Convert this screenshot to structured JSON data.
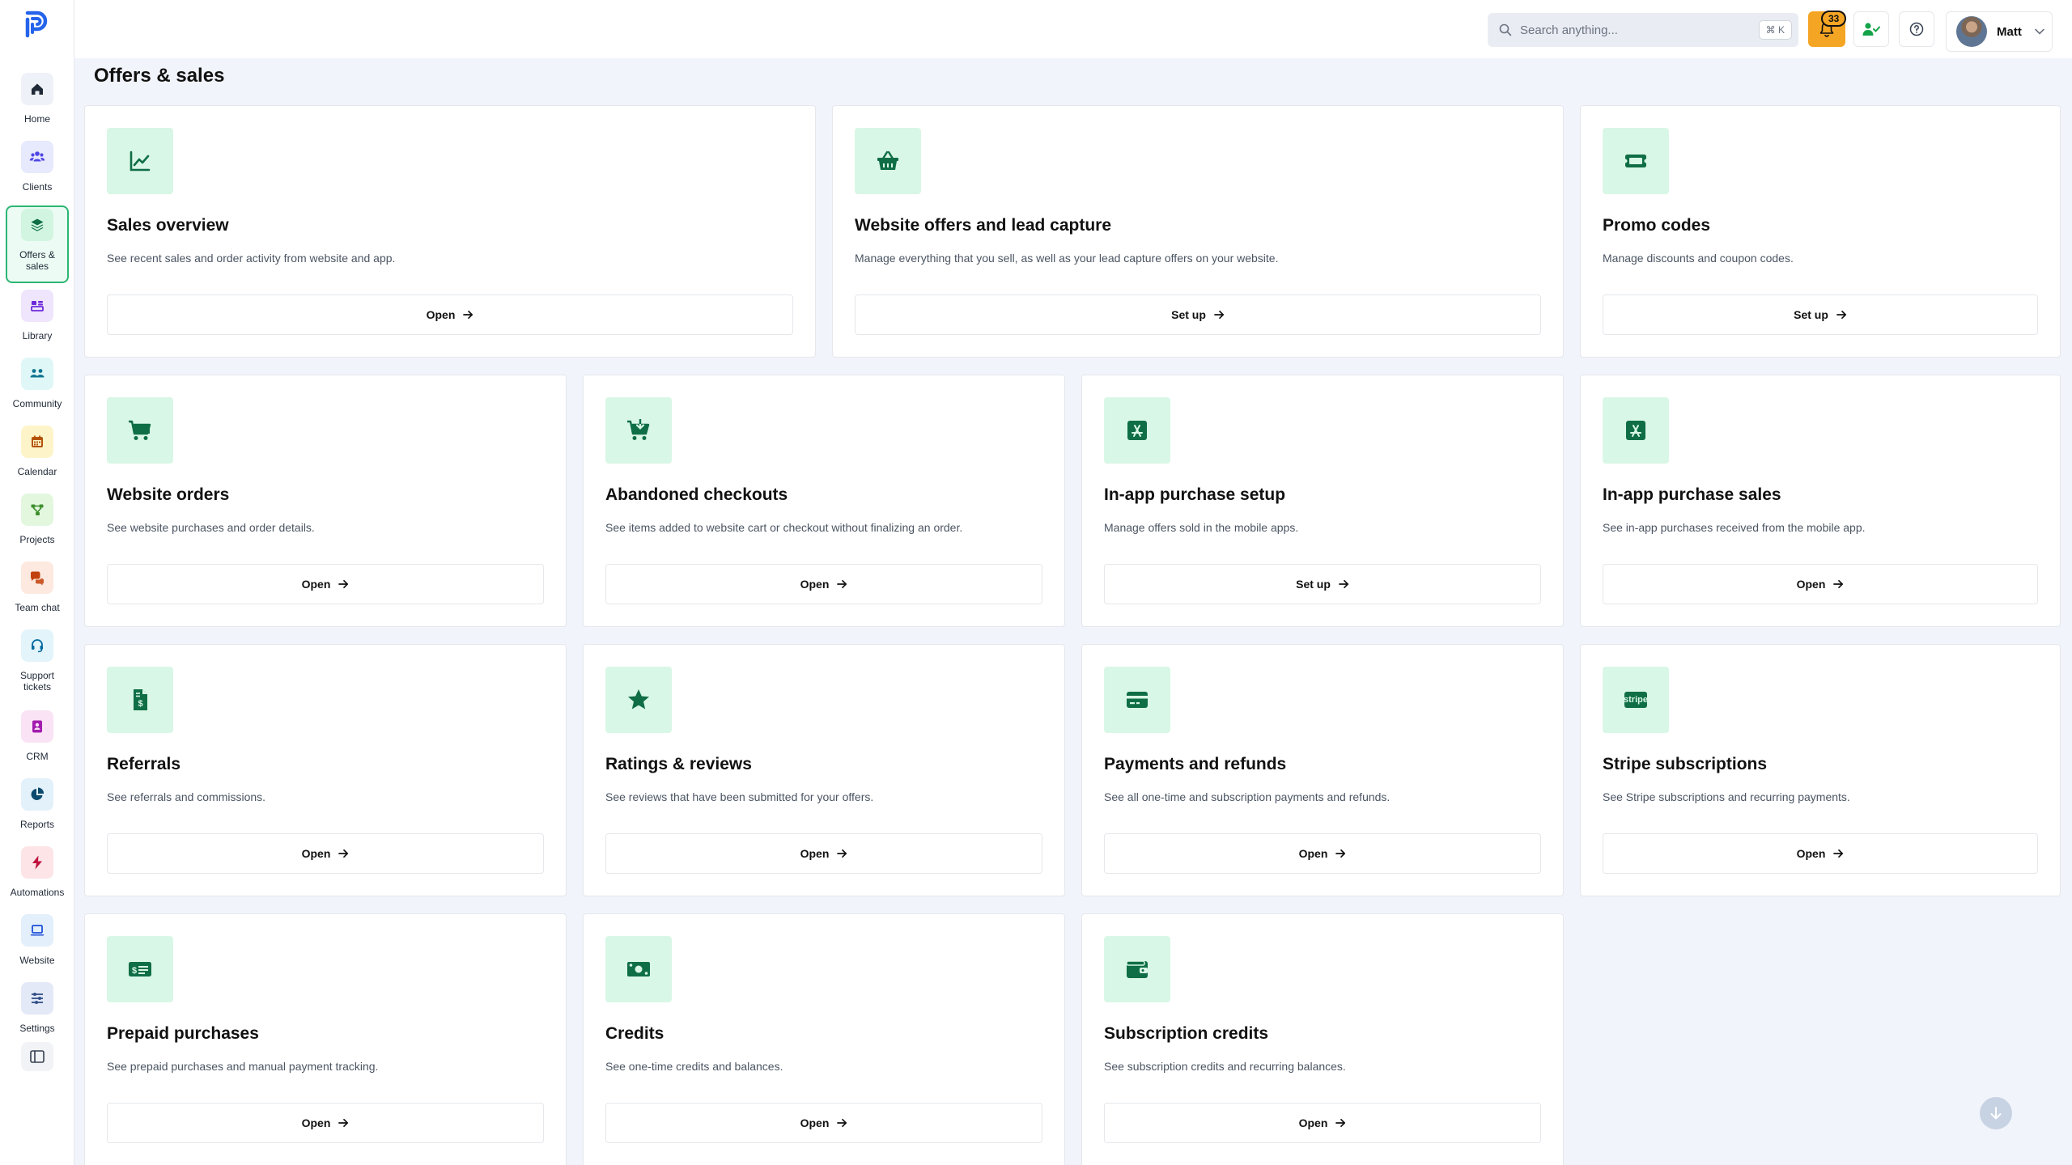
{
  "app": {
    "title": "Offers & sales"
  },
  "sidebar": {
    "items": [
      {
        "label": "Home",
        "icon": "home-icon",
        "bg": "#eef1f7",
        "fg": "#1f2937"
      },
      {
        "label": "Clients",
        "icon": "users-icon",
        "bg": "#e7e9fd",
        "fg": "#4f46e5"
      },
      {
        "label": "Offers &\nsales",
        "icon": "layers-icon",
        "bg": "#d1f5e0",
        "fg": "#0f6e46"
      },
      {
        "label": "Library",
        "icon": "library-icon",
        "bg": "#efe5fd",
        "fg": "#6d28d9"
      },
      {
        "label": "Community",
        "icon": "community-icon",
        "bg": "#e0f7f7",
        "fg": "#0e7490"
      },
      {
        "label": "Calendar",
        "icon": "calendar-icon",
        "bg": "#fdf4c9",
        "fg": "#b45309"
      },
      {
        "label": "Projects",
        "icon": "projects-icon",
        "bg": "#e3f7df",
        "fg": "#3f8f2f"
      },
      {
        "label": "Team chat",
        "icon": "chat-icon",
        "bg": "#fde9df",
        "fg": "#c2410c"
      },
      {
        "label": "Support\ntickets",
        "icon": "headset-icon",
        "bg": "#e3f4fb",
        "fg": "#0369a1"
      },
      {
        "label": "CRM",
        "icon": "crm-icon",
        "bg": "#f9e3f5",
        "fg": "#a21caf"
      },
      {
        "label": "Reports",
        "icon": "pie-chart-icon",
        "bg": "#e3f1fb",
        "fg": "#0c4a6e"
      },
      {
        "label": "Automations",
        "icon": "bolt-icon",
        "bg": "#fde4e7",
        "fg": "#be123c"
      },
      {
        "label": "Website",
        "icon": "laptop-icon",
        "bg": "#e3effb",
        "fg": "#1d4ed8"
      },
      {
        "label": "Settings",
        "icon": "sliders-icon",
        "bg": "#e3e9f6",
        "fg": "#334e8a"
      }
    ]
  },
  "topbar": {
    "search_placeholder": "Search anything...",
    "search_shortcut": "⌘ K",
    "notifications_count": "33",
    "user_name": "Matt"
  },
  "main": {
    "title": "Offers & sales",
    "cards": [
      {
        "title": "Sales overview",
        "desc": "See recent sales and order activity from website and app.",
        "button": "Open",
        "icon": "line-chart-icon"
      },
      {
        "title": "Website offers and lead capture",
        "desc": "Manage everything that you sell, as well as your lead capture offers on your website.",
        "button": "Set up",
        "icon": "basket-icon"
      },
      {
        "title": "Promo codes",
        "desc": "Manage discounts and coupon codes.",
        "button": "Set up",
        "icon": "ticket-icon"
      },
      {
        "title": "Website orders",
        "desc": "See website purchases and order details.",
        "button": "Open",
        "icon": "cart-icon"
      },
      {
        "title": "Abandoned checkouts",
        "desc": "See items added to website cart or checkout without finalizing an order.",
        "button": "Open",
        "icon": "cart-arrow-icon"
      },
      {
        "title": "In-app purchase setup",
        "desc": "Manage offers sold in the mobile apps.",
        "button": "Set up",
        "icon": "app-store-icon"
      },
      {
        "title": "In-app purchase sales",
        "desc": "See in-app purchases received from the mobile app.",
        "button": "Open",
        "icon": "app-store-icon"
      },
      {
        "title": "Referrals",
        "desc": "See referrals and commissions.",
        "button": "Open",
        "icon": "invoice-dollar-icon"
      },
      {
        "title": "Ratings & reviews",
        "desc": "See reviews that have been submitted for your offers.",
        "button": "Open",
        "icon": "star-icon"
      },
      {
        "title": "Payments and refunds",
        "desc": "See all one-time and subscription payments and refunds.",
        "button": "Open",
        "icon": "credit-card-icon"
      },
      {
        "title": "Stripe subscriptions",
        "desc": "See Stripe subscriptions and recurring payments.",
        "button": "Open",
        "icon": "stripe-icon",
        "icon_text": "stripe"
      },
      {
        "title": "Prepaid purchases",
        "desc": "See prepaid purchases and manual payment tracking.",
        "button": "Open",
        "icon": "money-check-icon"
      },
      {
        "title": "Credits",
        "desc": "See one-time credits and balances.",
        "button": "Open",
        "icon": "money-bill-icon"
      },
      {
        "title": "Subscription credits",
        "desc": "See subscription credits and recurring balances.",
        "button": "Open",
        "icon": "wallet-icon"
      }
    ]
  },
  "colors": {
    "accent": "#0f6e46",
    "accent_bg": "#d9f7e6",
    "bell": "#f5a524",
    "page_bg": "#f1f4fb"
  }
}
